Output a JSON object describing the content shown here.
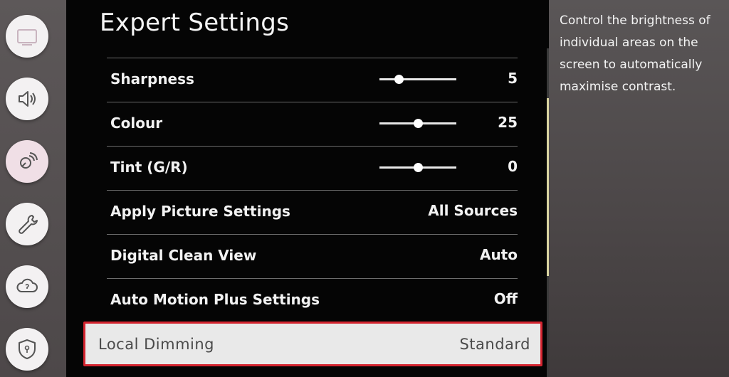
{
  "nav_icons": [
    {
      "name": "picture-icon",
      "active": false
    },
    {
      "name": "sound-icon",
      "active": false
    },
    {
      "name": "broadcasting-icon",
      "active": true
    },
    {
      "name": "general-icon",
      "active": false
    },
    {
      "name": "support-icon",
      "active": false
    },
    {
      "name": "privacy-icon",
      "active": false
    }
  ],
  "menu": {
    "title": "Expert Settings",
    "rows": [
      {
        "label": "Sharpness",
        "value": "5",
        "slider_fraction": 0.25
      },
      {
        "label": "Colour",
        "value": "25",
        "slider_fraction": 0.5
      },
      {
        "label": "Tint (G/R)",
        "value": "0",
        "slider_fraction": 0.5
      },
      {
        "label": "Apply Picture Settings",
        "value": "All Sources"
      },
      {
        "label": "Digital Clean View",
        "value": "Auto"
      },
      {
        "label": "Auto Motion Plus Settings",
        "value": "Off"
      }
    ],
    "selected": {
      "label": "Local Dimming",
      "value": "Standard"
    }
  },
  "help": {
    "text": "Control the brightness of individual areas on the screen to automatically maximise contrast."
  },
  "colors": {
    "selection_border": "#d4242f",
    "panel_background": "#050505",
    "selected_background": "#e9e9e9"
  }
}
